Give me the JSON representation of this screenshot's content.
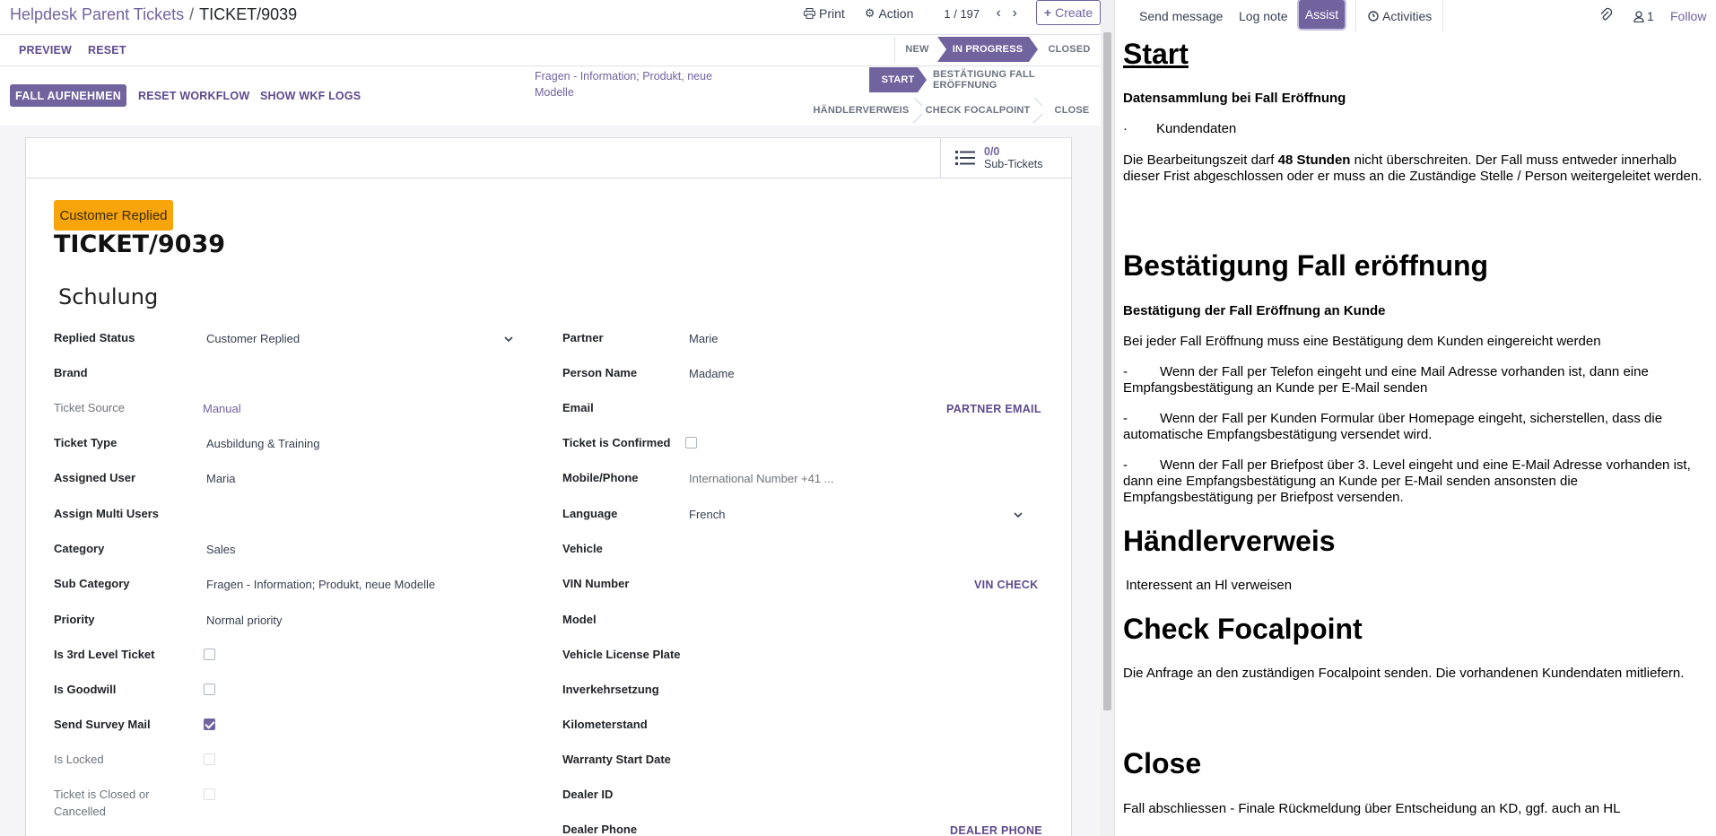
{
  "breadcrumb": {
    "parent": "Helpdesk Parent Tickets",
    "separator": "/",
    "current": "TICKET/9039"
  },
  "toolbar": {
    "print": "Print",
    "action": "Action",
    "pager": "1 / 197",
    "create": "Create"
  },
  "subbar": {
    "preview": "PREVIEW",
    "reset": "RESET"
  },
  "states": {
    "new": "NEW",
    "in_progress": "IN PROGRESS",
    "closed": "CLOSED"
  },
  "actions": {
    "fall_aufnehmen": "FALL AUFNEHMEN",
    "reset_workflow": "RESET WORKFLOW",
    "show_wkf_logs": "SHOW WKF LOGS"
  },
  "subcategory_note": "Fragen - Information; Produkt, neue Modelle",
  "workflow": {
    "start": "START",
    "bestaetigung": "BESTÄTIGUNG FALL ERÖFFNUNG",
    "haendlerverweis": "HÄNDLERVERWEIS",
    "check_focalpoint": "CHECK FOCALPOINT",
    "close": "CLOSE"
  },
  "subtickets": {
    "count": "0/0",
    "label": "Sub-Tickets"
  },
  "ticket": {
    "badge": "Customer Replied",
    "name": "TICKET/9039",
    "subject": "Schulung"
  },
  "left_fields": {
    "replied_status": {
      "label": "Replied Status",
      "value": "Customer Replied"
    },
    "brand": {
      "label": "Brand",
      "value": ""
    },
    "ticket_source": {
      "label": "Ticket Source",
      "value": "Manual"
    },
    "ticket_type": {
      "label": "Ticket Type",
      "value": "Ausbildung & Training"
    },
    "assigned_user": {
      "label": "Assigned User",
      "value": "Maria"
    },
    "assign_multi_users": {
      "label": "Assign Multi Users",
      "value": ""
    },
    "category": {
      "label": "Category",
      "value": "Sales"
    },
    "sub_category": {
      "label": "Sub Category",
      "value": "Fragen - Information; Produkt, neue Modelle"
    },
    "priority": {
      "label": "Priority",
      "value": "Normal priority"
    },
    "is_3rd_level": {
      "label": "Is 3rd Level Ticket"
    },
    "is_goodwill": {
      "label": "Is Goodwill"
    },
    "send_survey_mail": {
      "label": "Send Survey Mail"
    },
    "is_locked": {
      "label": "Is Locked"
    },
    "closed_or_cancelled": {
      "label": "Ticket is Closed or Cancelled"
    }
  },
  "right_fields": {
    "partner": {
      "label": "Partner",
      "value": "Marie"
    },
    "person_name": {
      "label": "Person Name",
      "value": "Madame"
    },
    "email": {
      "label": "Email",
      "button": "PARTNER EMAIL"
    },
    "ticket_confirmed": {
      "label": "Ticket is Confirmed"
    },
    "mobile": {
      "label": "Mobile/Phone",
      "placeholder": "International Number +41 ..."
    },
    "language": {
      "label": "Language",
      "value": "French"
    },
    "vehicle": {
      "label": "Vehicle"
    },
    "vin": {
      "label": "VIN Number",
      "button": "VIN CHECK"
    },
    "model": {
      "label": "Model"
    },
    "plate": {
      "label": "Vehicle License Plate"
    },
    "inverkehrsetzung": {
      "label": "Inverkehrsetzung"
    },
    "kilometerstand": {
      "label": "Kilometerstand"
    },
    "warranty_start": {
      "label": "Warranty Start Date"
    },
    "dealer_id": {
      "label": "Dealer ID"
    },
    "dealer_phone": {
      "label": "Dealer Phone",
      "button": "DEALER PHONE"
    }
  },
  "chatter": {
    "send_message": "Send message",
    "log_note": "Log note",
    "assist": "Assist",
    "activities": "Activities",
    "followers_count": "1",
    "follow": "Follow"
  },
  "doc": {
    "start": "Start",
    "datensammlung": "Datensammlung bei Fall Eröffnung",
    "kundendaten_bullet": "·",
    "kundendaten": "Kundendaten",
    "bearbeitung_pre": "Die Bearbeitungszeit darf ",
    "bearbeitung_bold": "48 Stunden",
    "bearbeitung_post": " nicht überschreiten. Der Fall muss entweder innerhalb dieser Frist abgeschlossen oder er muss an die Zuständige Stelle / Person weitergeleitet werden.",
    "bestaetigung_h": "Bestätigung Fall eröffnung",
    "bestaetigung_sub": "Bestätigung der Fall Eröffnung an Kunde",
    "bestaetigung_p": "Bei jeder Fall Eröffnung muss eine Bestätigung dem Kunden eingereicht werden",
    "dash": "-",
    "item1": "Wenn der Fall per Telefon eingeht und eine Mail Adresse vorhanden ist, dann eine Empfangsbestätigung an Kunde per E-Mail senden",
    "item2": "Wenn der Fall per Kunden Formular über Homepage eingeht, sicherstellen, dass die automatische Empfangsbestätigung versendet wird.",
    "item3": "Wenn der Fall per Briefpost über 3. Level eingeht und eine E-Mail Adresse vorhanden ist, dann eine Empfangsbestätigung an Kunde per E-Mail senden ansonsten die Empfangsbestätigung per Briefpost versenden.",
    "haendler_h": "Händlerverweis",
    "haendler_p": "Interessent an Hl verweisen",
    "focal_h": "Check Focalpoint",
    "focal_p": "Die Anfrage an den zuständigen Focalpoint senden. Die vorhandenen Kundendaten mitliefern.",
    "close_h": "Close",
    "close_p": "Fall abschliessen - Finale Rückmeldung über Entscheidung an KD, ggf. auch an HL"
  },
  "icons": {
    "print": "printer-icon",
    "action": "gear-icon",
    "activities": "clock-icon",
    "attach": "paperclip-icon",
    "followers": "person-icon",
    "subtickets": "list-icon"
  },
  "colors": {
    "accent": "#71639e",
    "badge": "#f8a50b"
  }
}
